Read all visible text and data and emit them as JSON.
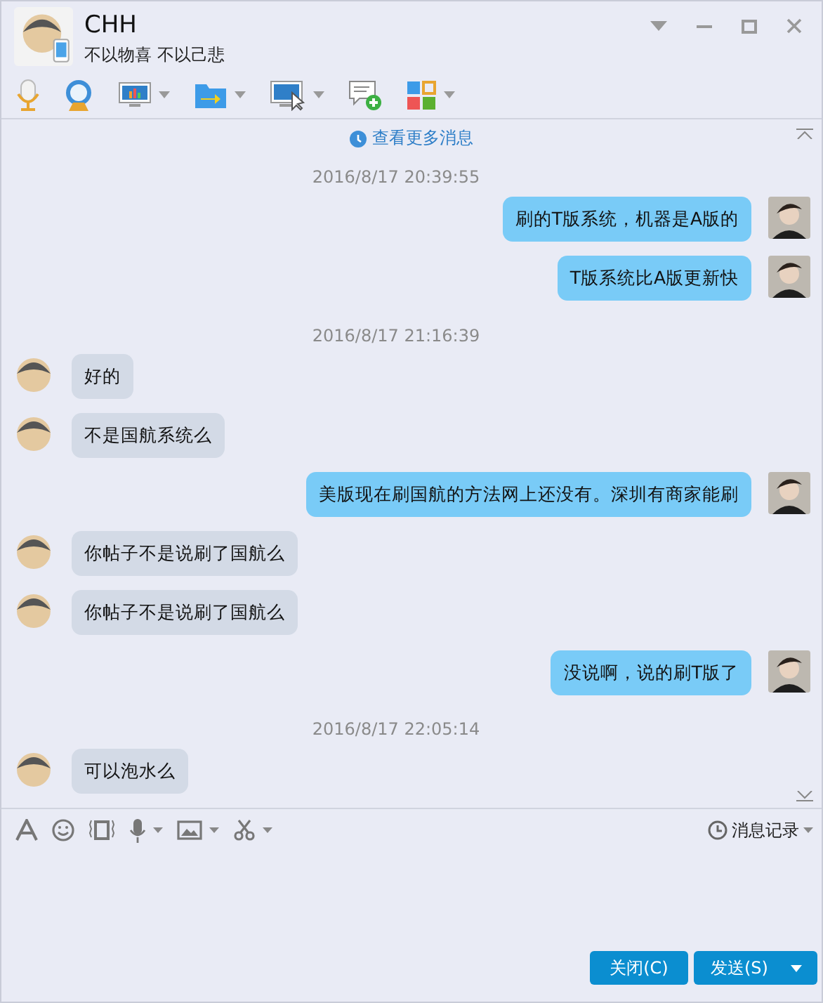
{
  "window": {
    "title": "CHH",
    "status": "不以物喜 不以己悲"
  },
  "toolbar": [
    {
      "kind": "mic",
      "menu": false
    },
    {
      "kind": "camera",
      "menu": false
    },
    {
      "kind": "screen",
      "menu": true
    },
    {
      "kind": "file",
      "menu": true
    },
    {
      "kind": "remote",
      "menu": true
    },
    {
      "kind": "chat-add",
      "menu": false
    },
    {
      "kind": "apps",
      "menu": true
    }
  ],
  "chat": {
    "more_link": "查看更多消息",
    "messages": [
      {
        "kind": "time",
        "text": "2016/8/17 20:39:55"
      },
      {
        "kind": "sent",
        "text": "刷的T版系统，机器是A版的"
      },
      {
        "kind": "sent",
        "text": "T版系统比A版更新快"
      },
      {
        "kind": "time",
        "text": "2016/8/17 21:16:39"
      },
      {
        "kind": "received",
        "text": "好的"
      },
      {
        "kind": "received",
        "text": "不是国航系统么"
      },
      {
        "kind": "sent",
        "text": "美版现在刷国航的方法网上还没有。深圳有商家能刷"
      },
      {
        "kind": "received",
        "text": "你帖子不是说刷了国航么"
      },
      {
        "kind": "received",
        "text": "你帖子不是说刷了国航么"
      },
      {
        "kind": "sent",
        "text": "没说啊，说的刷T版了"
      },
      {
        "kind": "time",
        "text": "2016/8/17 22:05:14"
      },
      {
        "kind": "received",
        "text": "可以泡水么"
      }
    ]
  },
  "input_toolbar": {
    "tools": [
      {
        "kind": "font",
        "menu": false
      },
      {
        "kind": "emoji",
        "menu": false
      },
      {
        "kind": "shake",
        "menu": false
      },
      {
        "kind": "voice",
        "menu": true
      },
      {
        "kind": "image",
        "menu": true
      },
      {
        "kind": "screenshot",
        "menu": true
      }
    ],
    "history": "消息记录"
  },
  "buttons": [
    {
      "label": "关闭(C)",
      "menu": false
    },
    {
      "label": "发送(S)",
      "menu": true
    }
  ]
}
